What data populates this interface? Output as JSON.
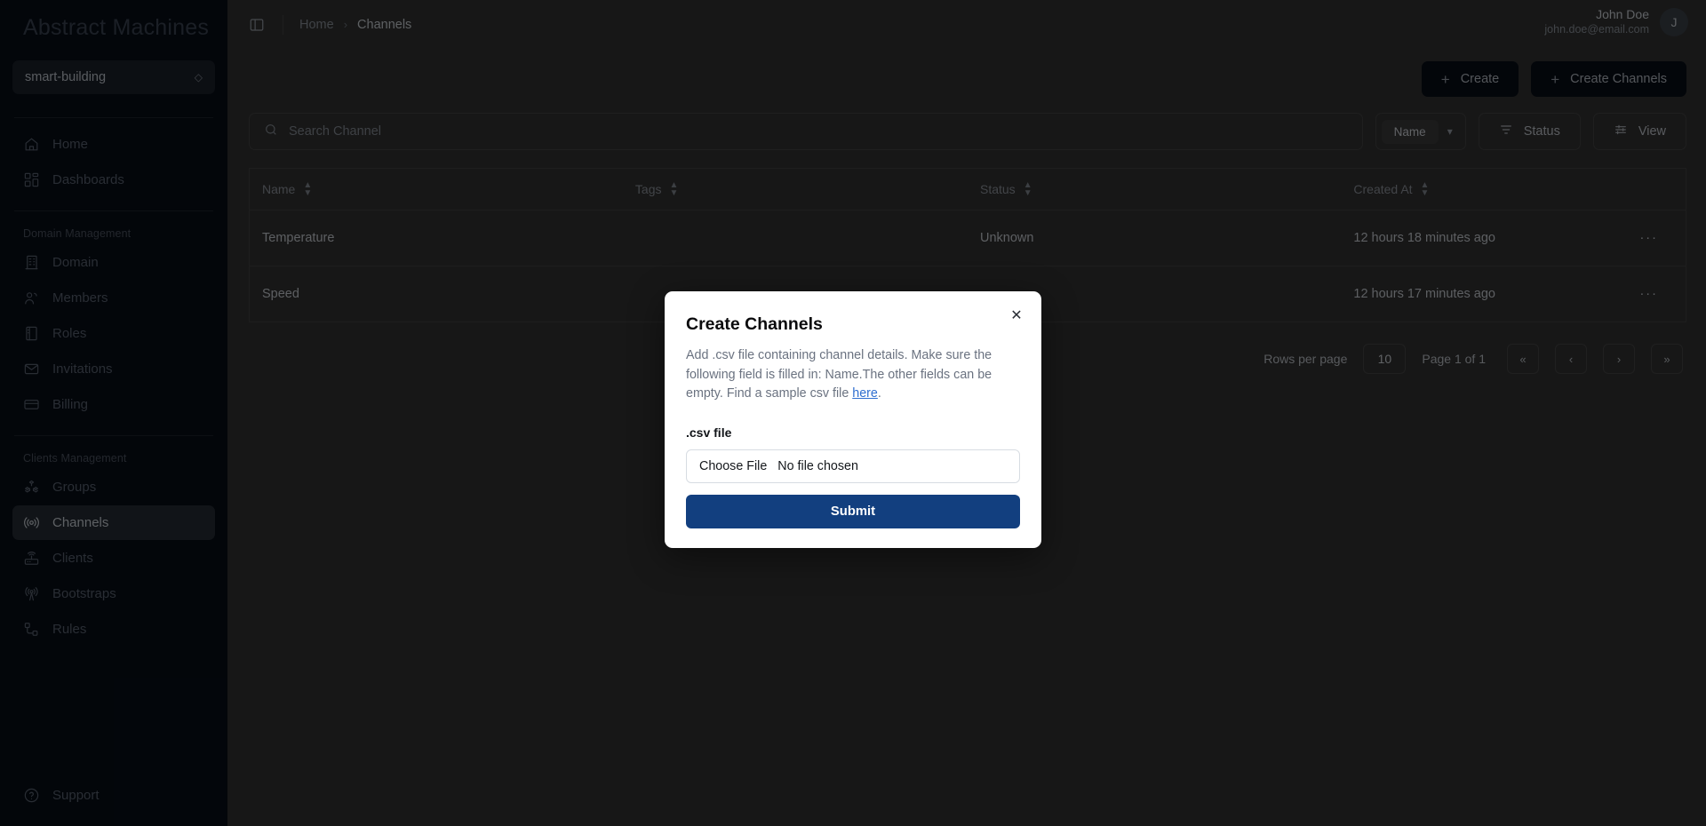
{
  "brand": {
    "name": "Abstract Machines"
  },
  "org_selector": {
    "value": "smart-building",
    "icon": "chevron-updown-icon"
  },
  "sidebar": {
    "groups": [
      {
        "label": null,
        "items": [
          {
            "label": "Home",
            "icon": "home-icon",
            "active": false
          },
          {
            "label": "Dashboards",
            "icon": "dashboards-icon",
            "active": false
          }
        ]
      },
      {
        "label": "Domain Management",
        "items": [
          {
            "label": "Domain",
            "icon": "building-icon",
            "active": false
          },
          {
            "label": "Members",
            "icon": "users-icon",
            "active": false
          },
          {
            "label": "Roles",
            "icon": "book-icon",
            "active": false
          },
          {
            "label": "Invitations",
            "icon": "mail-icon",
            "active": false
          },
          {
            "label": "Billing",
            "icon": "credit-card-icon",
            "active": false
          }
        ]
      },
      {
        "label": "Clients Management",
        "items": [
          {
            "label": "Groups",
            "icon": "boxes-icon",
            "active": false
          },
          {
            "label": "Channels",
            "icon": "broadcast-icon",
            "active": true
          },
          {
            "label": "Clients",
            "icon": "router-icon",
            "active": false
          },
          {
            "label": "Bootstraps",
            "icon": "antenna-icon",
            "active": false
          },
          {
            "label": "Rules",
            "icon": "workflow-icon",
            "active": false
          }
        ]
      }
    ],
    "support": {
      "label": "Support",
      "icon": "help-circle-icon"
    }
  },
  "topbar": {
    "panel_toggle_icon": "panel-left-icon",
    "breadcrumb": {
      "home": "Home",
      "separator": "›",
      "current": "Channels"
    },
    "user": {
      "name": "John Doe",
      "email": "john.doe@email.com",
      "avatar_initial": "J"
    }
  },
  "actions": {
    "create": {
      "label": "Create",
      "icon": "plus-icon"
    },
    "create_channels": {
      "label": "Create Channels",
      "icon": "plus-icon"
    }
  },
  "toolbar": {
    "search": {
      "placeholder": "Search Channel",
      "value": "",
      "icon": "search-icon"
    },
    "sort": {
      "value": "Name",
      "chevron": "chevron-down-icon"
    },
    "status_button": {
      "label": "Status",
      "icon": "filter-icon"
    },
    "view_button": {
      "label": "View",
      "icon": "sliders-icon"
    }
  },
  "table": {
    "columns": [
      {
        "label": "Name",
        "sortable": true
      },
      {
        "label": "Tags",
        "sortable": true
      },
      {
        "label": "Status",
        "sortable": true
      },
      {
        "label": "Created At",
        "sortable": true
      },
      {
        "label": "",
        "sortable": false
      }
    ],
    "rows": [
      {
        "name": "Temperature",
        "tags": "",
        "status": "Unknown",
        "created_at": "12 hours 18 minutes ago",
        "menu": "···"
      },
      {
        "name": "Speed",
        "tags": "",
        "status": "",
        "created_at": "12 hours 17 minutes ago",
        "menu": "···"
      }
    ]
  },
  "pagination": {
    "rows_per_page_label": "Rows per page",
    "rows_per_page_value": "10",
    "page_of": "Page 1 of 1",
    "first": "«",
    "prev": "‹",
    "next": "›",
    "last": "»"
  },
  "modal": {
    "title": "Create Channels",
    "close_icon": "close-icon",
    "description_part1": "Add .csv file containing channel details. Make sure the following field is filled in: Name.The other fields can be empty. Find a sample csv file ",
    "description_link": "here",
    "description_part2": ".",
    "field_label": ".csv file",
    "file_button_label": "Choose File",
    "file_status": "No file chosen",
    "submit_label": "Submit"
  },
  "colors": {
    "sidebar_bg": "#070e18",
    "app_bg": "#333333",
    "accent": "#123f7f",
    "link": "#2f6fd0",
    "active_nav_bg": "#262d36"
  }
}
